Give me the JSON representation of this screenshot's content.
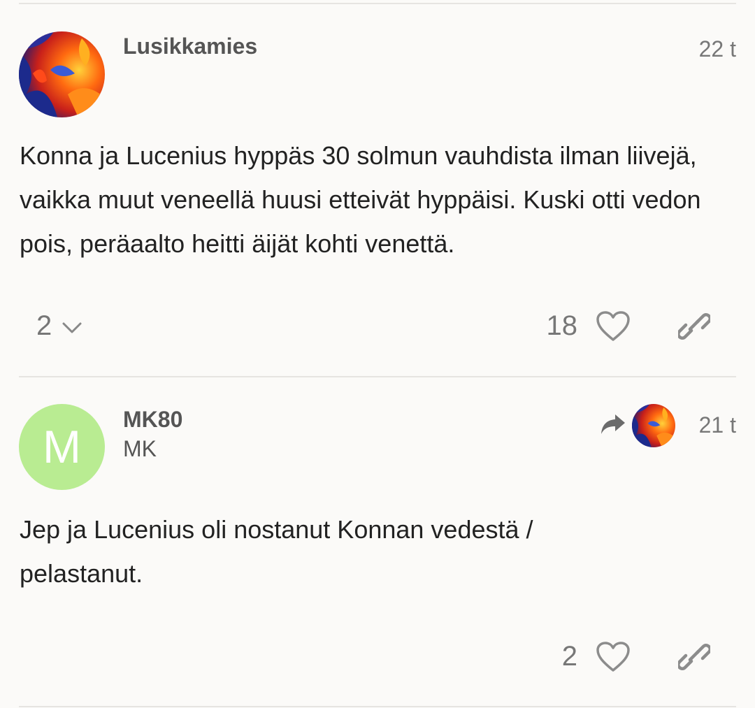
{
  "posts": [
    {
      "username": "Lusikkamies",
      "time": "22 t",
      "body": "Konna ja Lucenius hyppäs 30 solmun vauhdista ilman liivejä, vaikka muut veneellä huusi etteivät hyppäisi. Kuski otti vedon pois, peräaalto heitti äijät kohti venettä.",
      "replies": "2",
      "likes": "18",
      "icons": [
        "avatar-fractal",
        "chevron-down-icon",
        "heart-icon",
        "link-icon"
      ]
    },
    {
      "username": "MK80",
      "fullname": "MK",
      "avatar_letter": "M",
      "avatar_color": "#b9ec92",
      "time": "21 t",
      "body": "Jep ja Lucenius oli nostanut Konnan vedestä / pelastanut.",
      "likes": "2",
      "icons": [
        "reply-arrow-icon",
        "heart-icon",
        "link-icon"
      ]
    }
  ],
  "colors": {
    "background": "#fbfaf8",
    "muted": "#777777",
    "divider": "#e6e4e1"
  }
}
